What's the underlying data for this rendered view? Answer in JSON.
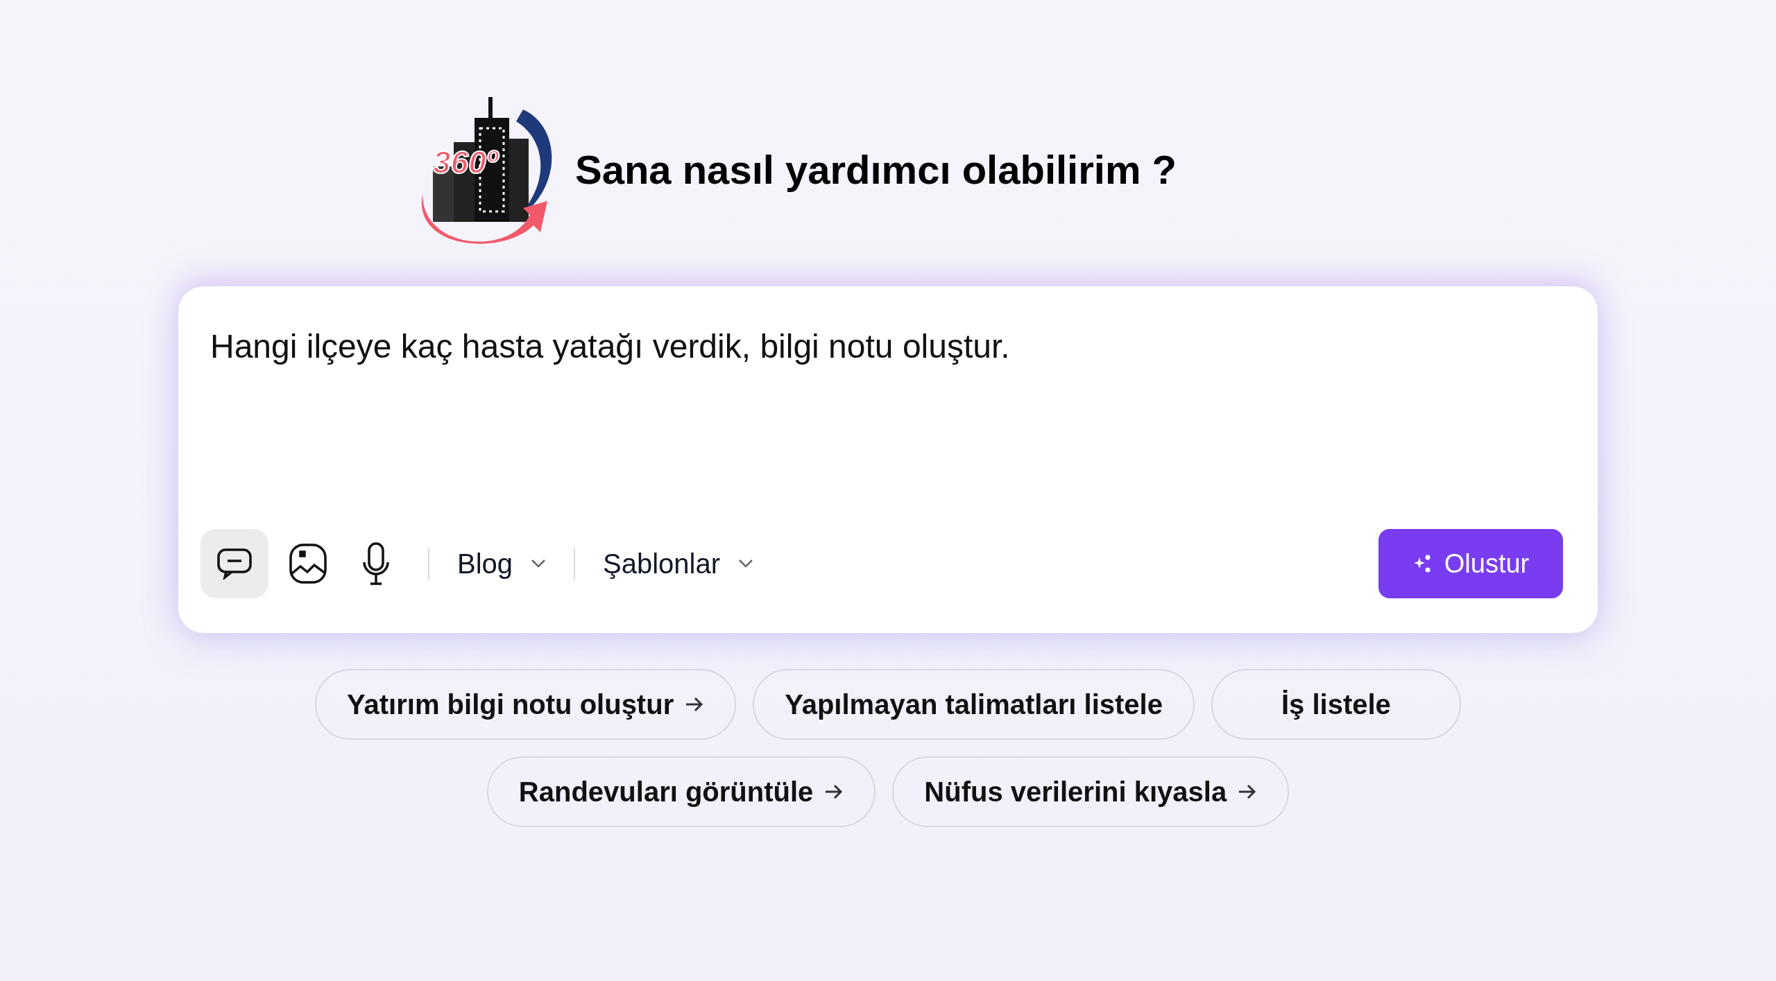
{
  "logo": {
    "text": "360º"
  },
  "heading": "Sana nasıl yardımcı olabilirim ?",
  "prompt": {
    "value": "Hangi ilçeye kaç hasta yatağı verdik, bilgi notu oluştur."
  },
  "toolbar": {
    "modes": [
      {
        "kind": "chat",
        "selected": true
      },
      {
        "kind": "image",
        "selected": false
      },
      {
        "kind": "voice",
        "selected": false
      }
    ],
    "dropdowns": [
      {
        "label": "Blog"
      },
      {
        "label": "Şablonlar"
      }
    ],
    "submit": "Olustur"
  },
  "suggestions": [
    {
      "label": "Yatırım bilgi notu oluştur",
      "arrow": true
    },
    {
      "label": "Yapılmayan talimatları listele",
      "arrow": false
    },
    {
      "label": "İş listele",
      "arrow": false
    },
    {
      "label": "Randevuları görüntüle",
      "arrow": true
    },
    {
      "label": "Nüfus verilerini kıyasla",
      "arrow": true
    }
  ]
}
